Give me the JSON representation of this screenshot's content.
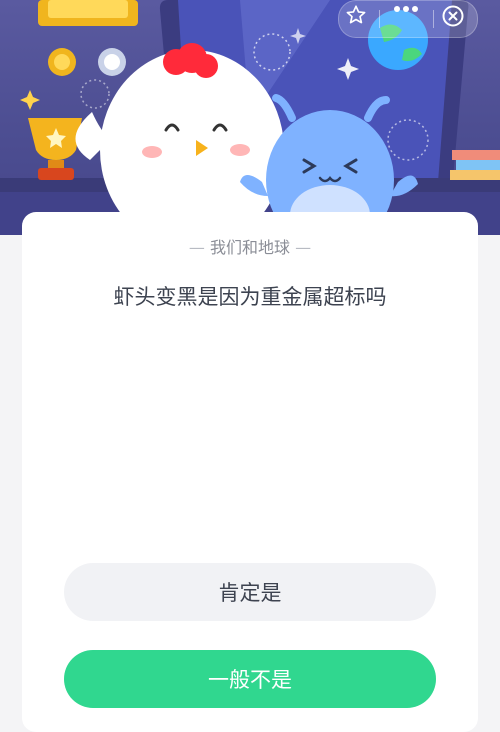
{
  "header": {
    "actions": [
      {
        "name": "favorite",
        "icon": "star-icon"
      },
      {
        "name": "more",
        "icon": "more-dots-icon"
      },
      {
        "name": "close",
        "icon": "close-circle-icon"
      }
    ]
  },
  "quiz": {
    "topic": "我们和地球",
    "question": "虾头变黑是因为重金属超标吗",
    "options": [
      {
        "label": "肯定是",
        "selected": false
      },
      {
        "label": "一般不是",
        "selected": true
      }
    ]
  },
  "colors": {
    "accent": "#30d78f",
    "banner": "#4d4e92",
    "text": "#3d4350",
    "muted": "#8a8d96"
  }
}
